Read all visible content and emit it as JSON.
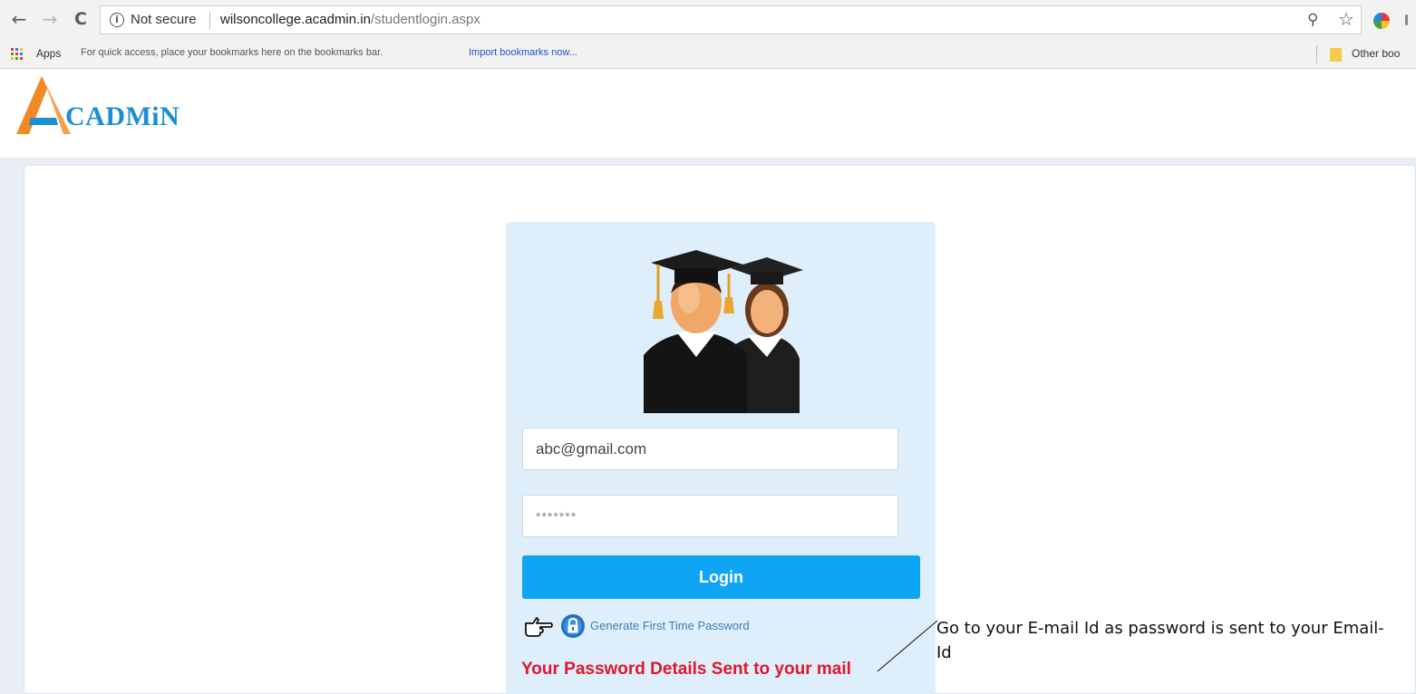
{
  "browser": {
    "security_label": "Not secure",
    "url_host": "wilsoncollege.acadmin.in",
    "url_path": "/studentlogin.aspx",
    "info_icon_glyph": "i",
    "bookmarks_bar": {
      "apps_label": "Apps",
      "hint": "For quick access, place your bookmarks here on the bookmarks bar.",
      "import_link": "Import bookmarks now...",
      "other_bookmarks": "Other boo"
    },
    "icons": [
      "back-arrow-icon",
      "forward-arrow-icon",
      "reload-icon",
      "info-icon",
      "key-icon",
      "star-icon",
      "extension-icon",
      "apps-grid-icon",
      "folder-icon"
    ]
  },
  "logo": {
    "text": "CADMiN",
    "colors": {
      "orange": "#f08a24",
      "blue": "#1b8fd4"
    }
  },
  "login": {
    "email_value": "abc@gmail.com",
    "password_value": "*******",
    "login_label": "Login",
    "generate_link": "Generate First Time Password",
    "status_message": "Your Password Details Sent to your mail",
    "icons": [
      "graduates-avatar-icon",
      "pointing-hand-icon",
      "lock-icon"
    ]
  },
  "annotation": {
    "text": "Go to your E-mail Id as password is sent to your Email-Id"
  },
  "colors": {
    "login_button": "#0ea5f5",
    "status_red": "#e0162b",
    "card_bg": "#dfeefb",
    "link": "#3b7fb0"
  }
}
